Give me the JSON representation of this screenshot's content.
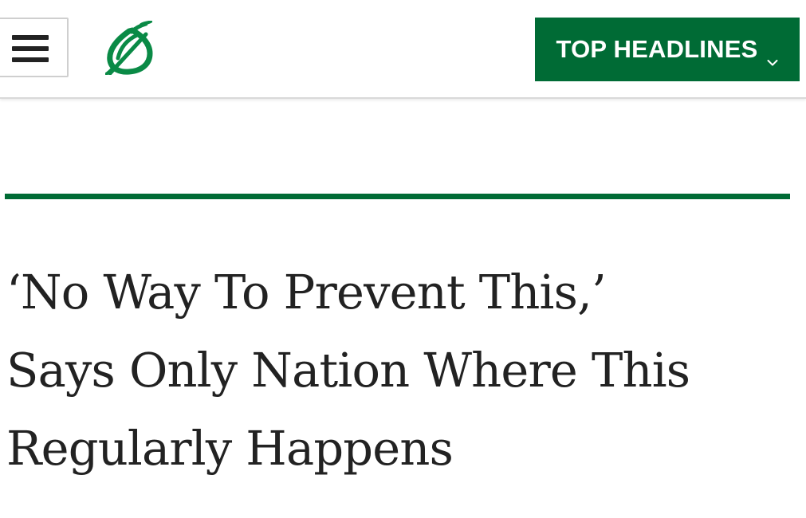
{
  "header": {
    "menu_icon": "hamburger-icon",
    "logo_icon": "onion-logo-icon",
    "brand_color": "#006b35",
    "top_headlines_label": "TOP HEADLINES",
    "top_headlines_icon": "chevron-down-icon"
  },
  "article": {
    "headline_lines": [
      "‘No Way To Prevent This,’",
      "Says Only Nation Where This",
      "Regularly Happens"
    ]
  }
}
